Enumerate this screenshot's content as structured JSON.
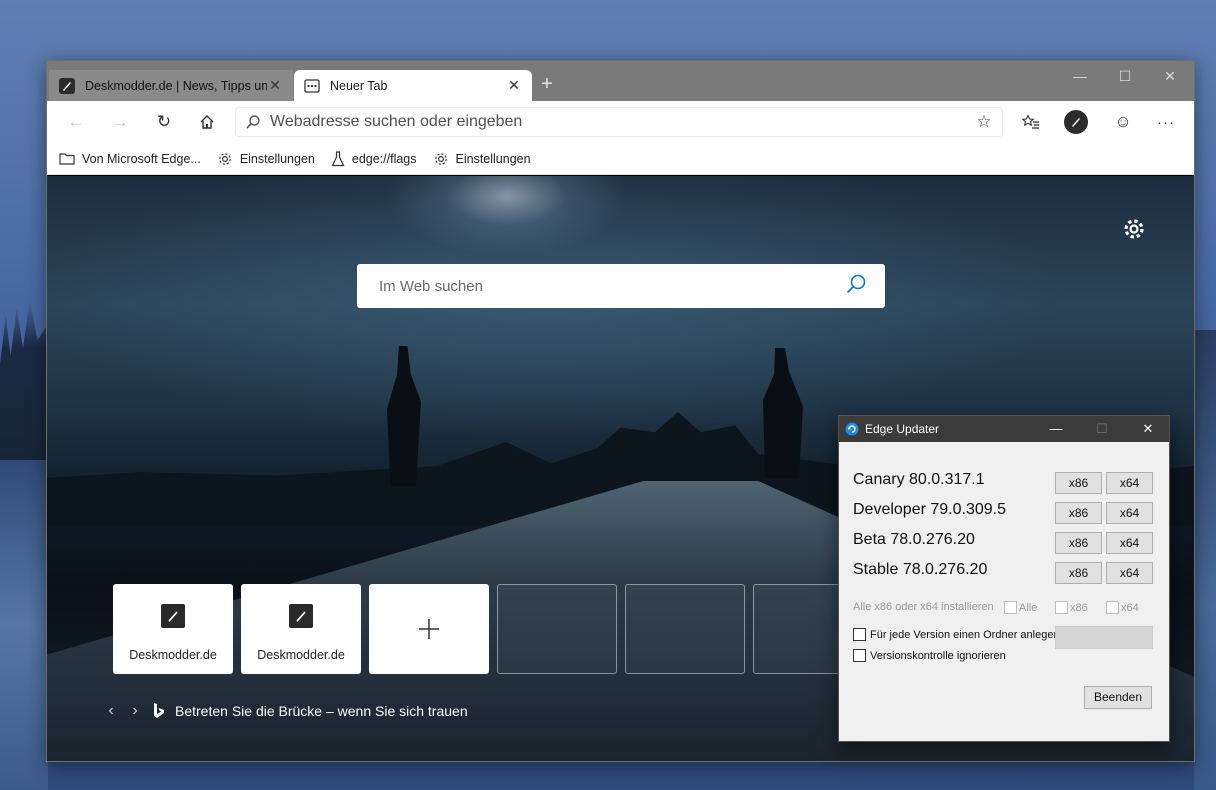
{
  "browser": {
    "tabs": [
      {
        "label": "Deskmodder.de | News, Tipps und",
        "close": "✕",
        "icon": "brush-icon",
        "active": false
      },
      {
        "label": "Neuer Tab",
        "close": "✕",
        "icon": "newtab-icon",
        "active": true
      }
    ],
    "new_tab_button": "+",
    "window_controls": {
      "minimize": "—",
      "maximize": "☐",
      "close": "✕"
    },
    "toolbar": {
      "back": "←",
      "forward": "→",
      "refresh": "↻",
      "address_placeholder": "Webadresse suchen oder eingeben",
      "favorite_star": "☆",
      "more": "···",
      "emoji": "☺"
    },
    "favorites": [
      {
        "label": "Von Microsoft Edge...",
        "icon": "folder-icon"
      },
      {
        "label": "Einstellungen",
        "icon": "gear-icon"
      },
      {
        "label": "edge://flags",
        "icon": "flask-icon"
      },
      {
        "label": "Einstellungen",
        "icon": "gear-icon"
      }
    ]
  },
  "ntp": {
    "search_placeholder": "Im Web suchen",
    "tiles": [
      {
        "label": "Deskmodder.de"
      },
      {
        "label": "Deskmodder.de"
      }
    ],
    "add_tile": "+",
    "caption": "Betreten Sie die Brücke – wenn Sie sich trauen",
    "caption_prev": "‹",
    "caption_next": "›"
  },
  "updater": {
    "title": "Edge Updater",
    "controls": {
      "minimize": "—",
      "maximize": "☐",
      "close": "✕"
    },
    "versions": [
      {
        "label": "Canary 80.0.317.1",
        "x86": "x86",
        "x64": "x64"
      },
      {
        "label": "Developer 79.0.309.5",
        "x86": "x86",
        "x64": "x64"
      },
      {
        "label": "Beta 78.0.276.20",
        "x86": "x86",
        "x64": "x64"
      },
      {
        "label": "Stable 78.0.276.20",
        "x86": "x86",
        "x64": "x64"
      }
    ],
    "install_all_label": "Alle x86 oder x64 installieren",
    "option_all": "Alle",
    "option_x86": "x86",
    "option_x64": "x64",
    "folder_option": "Für jede Version einen Ordner anlegen",
    "ignore_version": "Versionskontrolle ignorieren",
    "exit_button": "Beenden"
  },
  "colors": {
    "titlebar": "#7a7a7a",
    "dialog_title": "#3b3b3b",
    "accent_blue": "#0078d4"
  }
}
